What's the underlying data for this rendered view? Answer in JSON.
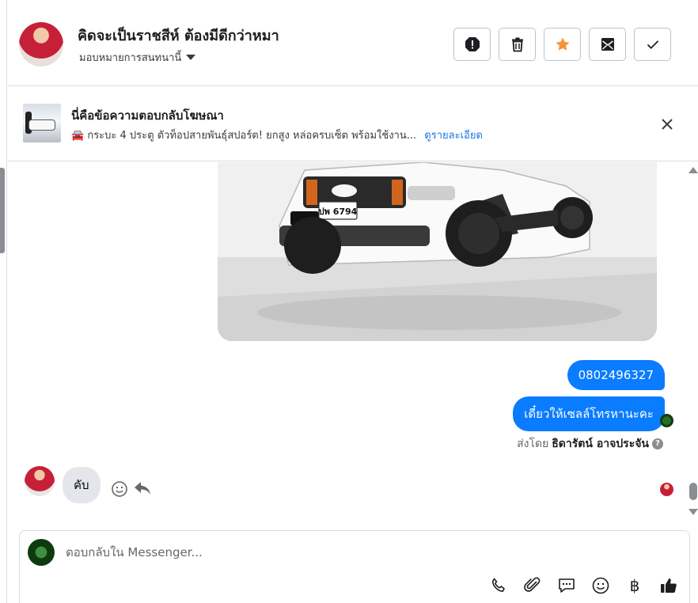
{
  "header": {
    "customer_name": "คิดจะเป็นราชสีห์ ต้องมีดีกว่าหมา",
    "assign_label": "มอบหมายการสนทนานี้",
    "actions": [
      {
        "name": "report-button",
        "icon": "alert-octagon-icon"
      },
      {
        "name": "delete-button",
        "icon": "trash-icon"
      },
      {
        "name": "star-button",
        "icon": "star-icon",
        "color": "#f7923b"
      },
      {
        "name": "mark-unread-button",
        "icon": "envelope-icon"
      },
      {
        "name": "mark-done-button",
        "icon": "check-icon"
      }
    ]
  },
  "ad_reply": {
    "title": "นี่คือข้อความตอบกลับโฆษณา",
    "snippet": "🚘 กระบะ 4 ประตู ตัวท็อปสายพันธุ์สปอร์ต! ยกสูง หล่อครบเซ็ต พร้อมใช้งาน...",
    "details_link": "ดูรายละเอียด"
  },
  "messages": {
    "image_plate": "ปพ 6794",
    "outgoing": [
      "0802496327",
      "เดี๋ยวให้เซลล์โทรหานะคะ"
    ],
    "sent_by_prefix": "ส่งโดย",
    "sent_by_name": "ธิดารัตน์ อาจประจัน",
    "help_mark": "?",
    "incoming": [
      "คับ"
    ]
  },
  "composer": {
    "placeholder": "ตอบกลับใน Messenger...",
    "currency_symbol": "฿",
    "tools": [
      "phone-icon",
      "paperclip-icon",
      "saved-reply-icon",
      "emoji-icon",
      "baht-icon",
      "thumbs-up-icon"
    ]
  },
  "colors": {
    "accent": "#0a7cff",
    "link": "#1b74e4",
    "star": "#f7923b"
  }
}
